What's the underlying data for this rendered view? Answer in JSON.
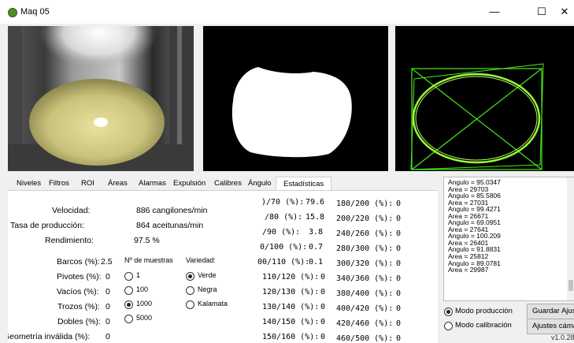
{
  "window": {
    "title": "Maq 05",
    "minimize": "—",
    "maximize": "☐",
    "close": "✕"
  },
  "tabs": [
    "Niveles",
    "Filtros",
    "ROI",
    "Áreas",
    "Alarmas",
    "Expulsión",
    "Calibres",
    "Ángulo",
    "Estadísticas"
  ],
  "active_tab": "Estadísticas",
  "stats": {
    "velocidad_label": "Velocidad:",
    "velocidad_value": "886 cangilones/min",
    "tasa_label": "Tasa de producción:",
    "tasa_value": "864 aceitunas/min",
    "rendimiento_label": "Rendimiento:",
    "rendimiento_value": "97.5 %"
  },
  "defects": [
    {
      "label": "Barcos (%):",
      "value": "2.5"
    },
    {
      "label": "Pivotes (%):",
      "value": "0"
    },
    {
      "label": "Vacíos (%):",
      "value": "0"
    },
    {
      "label": "Trozos (%):",
      "value": "0"
    },
    {
      "label": "Dobles (%):",
      "value": "0"
    },
    {
      "label": "Geometría inválida (%):",
      "value": "0"
    }
  ],
  "samples": {
    "title": "Nº de muestras",
    "options": [
      "1",
      "100",
      "1000",
      "5000"
    ],
    "selected": "1000"
  },
  "variety": {
    "title": "Variedad:",
    "options": [
      "Verde",
      "Negra",
      "Kalamata"
    ],
    "selected": "Verde"
  },
  "calibers_left": [
    {
      "label": ")/70 (%):",
      "value": "79.6"
    },
    {
      "label": "/80 (%):",
      "value": "15.8"
    },
    {
      "label": "/90 (%):",
      "value": "3.8"
    },
    {
      "label": "0/100 (%):",
      "value": "0.7"
    },
    {
      "label": "00/110 (%):",
      "value": "0.1"
    },
    {
      "label": "110/120 (%):",
      "value": "0"
    },
    {
      "label": "120/130 (%):",
      "value": "0"
    },
    {
      "label": "130/140 (%):",
      "value": "0"
    },
    {
      "label": "140/150 (%):",
      "value": "0"
    },
    {
      "label": "150/160 (%):",
      "value": "0"
    }
  ],
  "calibers_right": [
    {
      "label": "180/200 (%):",
      "value": "0"
    },
    {
      "label": "200/220 (%):",
      "value": "0"
    },
    {
      "label": "240/260 (%):",
      "value": "0"
    },
    {
      "label": "280/300 (%):",
      "value": "0"
    },
    {
      "label": "300/320 (%):",
      "value": "0"
    },
    {
      "label": "340/360 (%):",
      "value": "0"
    },
    {
      "label": "380/400 (%):",
      "value": "0"
    },
    {
      "label": "400/420 (%):",
      "value": "0"
    },
    {
      "label": "420/460 (%):",
      "value": "0"
    },
    {
      "label": "460/500 (%):",
      "value": "0"
    }
  ],
  "log_lines": [
    "Angulo = 95.0347",
    "Area = 29703",
    "Angulo = 85.5806",
    "Area = 27031",
    "Angulo = 99.4271",
    "Area = 26671",
    "Angulo = 69.0951",
    "Area = 27641",
    "Angulo = 100.209",
    "Area = 26401",
    "Angulo = 91.8831",
    "Area = 25812",
    "Angulo = 89.0781",
    "Area = 29987"
  ],
  "mode": {
    "production": "Modo producción",
    "calibration": "Modo calibración",
    "selected": "production"
  },
  "buttons": {
    "save": "Guardar Ajustes",
    "camera": "Ajustes cámara"
  },
  "version": "v1.0.28",
  "colors": {
    "olive": "#c9c27a",
    "contour": "#7cff1a",
    "box": "#49e81c"
  }
}
